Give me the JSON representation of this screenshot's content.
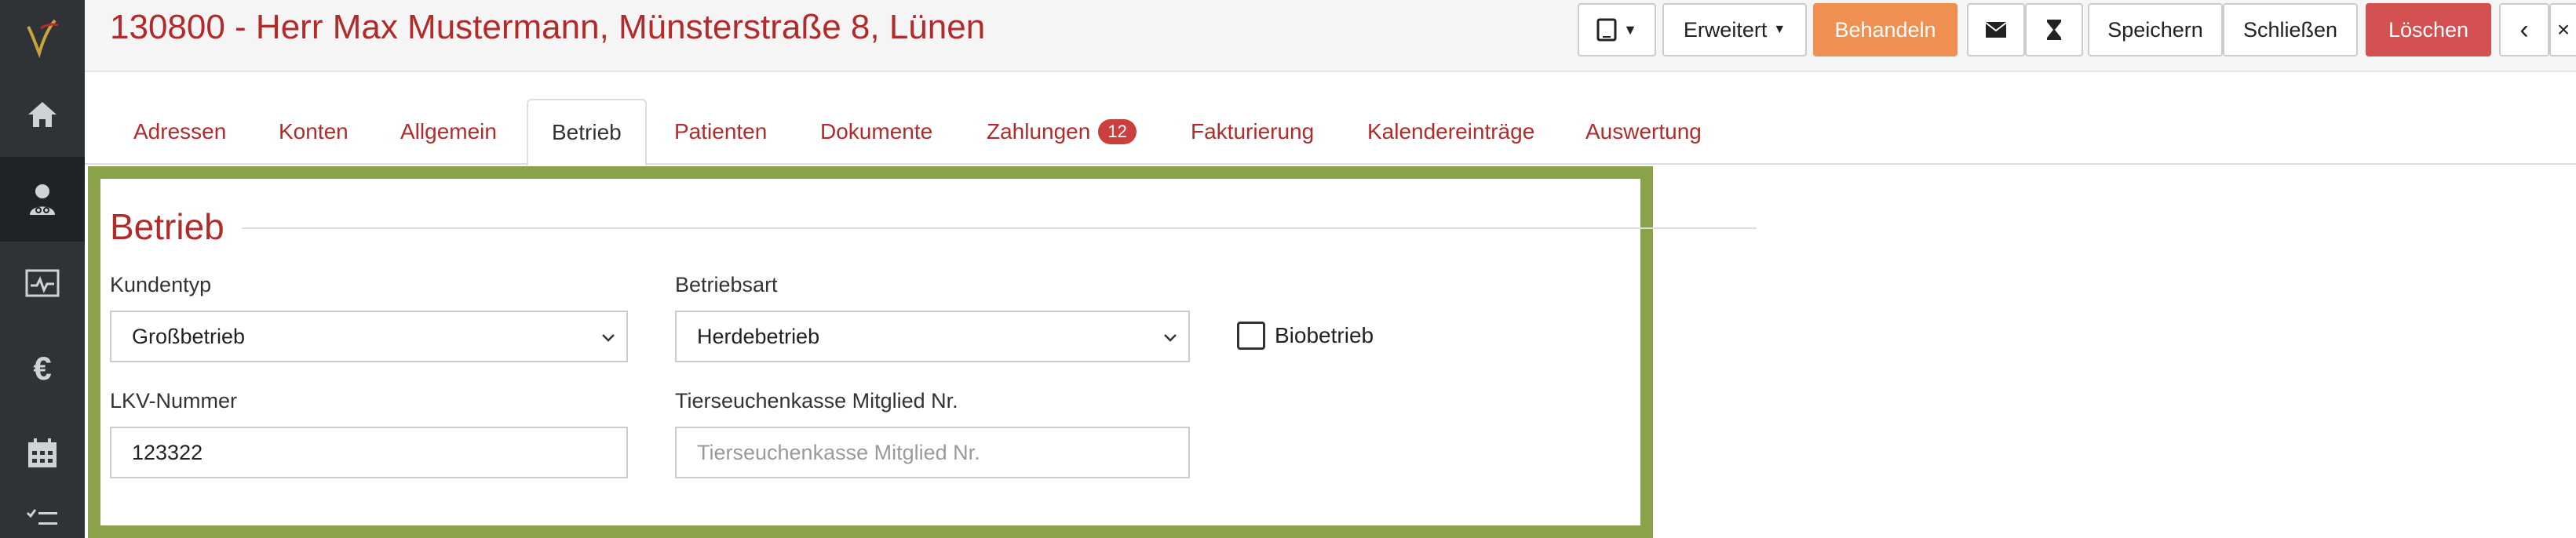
{
  "header": {
    "title": "130800 - Herr Max Mustermann, Münsterstraße 8, Lünen"
  },
  "toolbar": {
    "device_label": "",
    "erweitert_label": "Erweitert",
    "behandeln_label": "Behandeln",
    "speichern_label": "Speichern",
    "schliessen_label": "Schließen",
    "loeschen_label": "Löschen"
  },
  "sidebar": {
    "items": [
      {
        "icon": "home-icon"
      },
      {
        "icon": "user-icon"
      },
      {
        "icon": "monitor-icon"
      },
      {
        "icon": "euro-icon"
      },
      {
        "icon": "calendar-icon"
      },
      {
        "icon": "checklist-icon"
      }
    ]
  },
  "tabs": {
    "adressen": "Adressen",
    "konten": "Konten",
    "allgemein": "Allgemein",
    "betrieb": "Betrieb",
    "patienten": "Patienten",
    "dokumente": "Dokumente",
    "zahlungen": "Zahlungen",
    "zahlungen_count": "12",
    "fakturierung": "Fakturierung",
    "kalender": "Kalendereinträge",
    "auswertung": "Auswertung"
  },
  "form": {
    "section_title": "Betrieb",
    "kundentyp_label": "Kundentyp",
    "kundentyp_value": "Großbetrieb",
    "betriebsart_label": "Betriebsart",
    "betriebsart_value": "Herdebetrieb",
    "biobetrieb_label": "Biobetrieb",
    "biobetrieb_checked": false,
    "lkv_label": "LKV-Nummer",
    "lkv_value": "123322",
    "tsk_label": "Tierseuchenkasse Mitglied Nr.",
    "tsk_placeholder": "Tierseuchenkasse Mitglied Nr."
  },
  "colors": {
    "accent_red": "#b32a2a",
    "orange_button": "#ef9052",
    "delete_button": "#d35151",
    "highlight_frame": "#8aa24a",
    "sidebar": "#2f3338"
  }
}
